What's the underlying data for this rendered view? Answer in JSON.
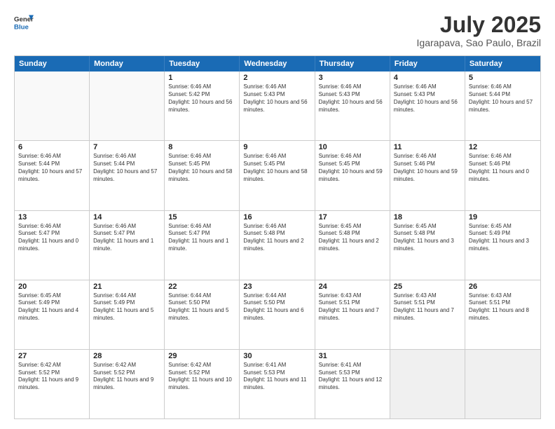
{
  "header": {
    "logo_line1": "General",
    "logo_line2": "Blue",
    "month_year": "July 2025",
    "location": "Igarapava, Sao Paulo, Brazil"
  },
  "weekdays": [
    "Sunday",
    "Monday",
    "Tuesday",
    "Wednesday",
    "Thursday",
    "Friday",
    "Saturday"
  ],
  "rows": [
    [
      {
        "day": "",
        "text": "",
        "empty": true
      },
      {
        "day": "",
        "text": "",
        "empty": true
      },
      {
        "day": "1",
        "text": "Sunrise: 6:46 AM\nSunset: 5:42 PM\nDaylight: 10 hours and 56 minutes."
      },
      {
        "day": "2",
        "text": "Sunrise: 6:46 AM\nSunset: 5:43 PM\nDaylight: 10 hours and 56 minutes."
      },
      {
        "day": "3",
        "text": "Sunrise: 6:46 AM\nSunset: 5:43 PM\nDaylight: 10 hours and 56 minutes."
      },
      {
        "day": "4",
        "text": "Sunrise: 6:46 AM\nSunset: 5:43 PM\nDaylight: 10 hours and 56 minutes."
      },
      {
        "day": "5",
        "text": "Sunrise: 6:46 AM\nSunset: 5:44 PM\nDaylight: 10 hours and 57 minutes."
      }
    ],
    [
      {
        "day": "6",
        "text": "Sunrise: 6:46 AM\nSunset: 5:44 PM\nDaylight: 10 hours and 57 minutes."
      },
      {
        "day": "7",
        "text": "Sunrise: 6:46 AM\nSunset: 5:44 PM\nDaylight: 10 hours and 57 minutes."
      },
      {
        "day": "8",
        "text": "Sunrise: 6:46 AM\nSunset: 5:45 PM\nDaylight: 10 hours and 58 minutes."
      },
      {
        "day": "9",
        "text": "Sunrise: 6:46 AM\nSunset: 5:45 PM\nDaylight: 10 hours and 58 minutes."
      },
      {
        "day": "10",
        "text": "Sunrise: 6:46 AM\nSunset: 5:45 PM\nDaylight: 10 hours and 59 minutes."
      },
      {
        "day": "11",
        "text": "Sunrise: 6:46 AM\nSunset: 5:46 PM\nDaylight: 10 hours and 59 minutes."
      },
      {
        "day": "12",
        "text": "Sunrise: 6:46 AM\nSunset: 5:46 PM\nDaylight: 11 hours and 0 minutes."
      }
    ],
    [
      {
        "day": "13",
        "text": "Sunrise: 6:46 AM\nSunset: 5:47 PM\nDaylight: 11 hours and 0 minutes."
      },
      {
        "day": "14",
        "text": "Sunrise: 6:46 AM\nSunset: 5:47 PM\nDaylight: 11 hours and 1 minute."
      },
      {
        "day": "15",
        "text": "Sunrise: 6:46 AM\nSunset: 5:47 PM\nDaylight: 11 hours and 1 minute."
      },
      {
        "day": "16",
        "text": "Sunrise: 6:46 AM\nSunset: 5:48 PM\nDaylight: 11 hours and 2 minutes."
      },
      {
        "day": "17",
        "text": "Sunrise: 6:45 AM\nSunset: 5:48 PM\nDaylight: 11 hours and 2 minutes."
      },
      {
        "day": "18",
        "text": "Sunrise: 6:45 AM\nSunset: 5:48 PM\nDaylight: 11 hours and 3 minutes."
      },
      {
        "day": "19",
        "text": "Sunrise: 6:45 AM\nSunset: 5:49 PM\nDaylight: 11 hours and 3 minutes."
      }
    ],
    [
      {
        "day": "20",
        "text": "Sunrise: 6:45 AM\nSunset: 5:49 PM\nDaylight: 11 hours and 4 minutes."
      },
      {
        "day": "21",
        "text": "Sunrise: 6:44 AM\nSunset: 5:49 PM\nDaylight: 11 hours and 5 minutes."
      },
      {
        "day": "22",
        "text": "Sunrise: 6:44 AM\nSunset: 5:50 PM\nDaylight: 11 hours and 5 minutes."
      },
      {
        "day": "23",
        "text": "Sunrise: 6:44 AM\nSunset: 5:50 PM\nDaylight: 11 hours and 6 minutes."
      },
      {
        "day": "24",
        "text": "Sunrise: 6:43 AM\nSunset: 5:51 PM\nDaylight: 11 hours and 7 minutes."
      },
      {
        "day": "25",
        "text": "Sunrise: 6:43 AM\nSunset: 5:51 PM\nDaylight: 11 hours and 7 minutes."
      },
      {
        "day": "26",
        "text": "Sunrise: 6:43 AM\nSunset: 5:51 PM\nDaylight: 11 hours and 8 minutes."
      }
    ],
    [
      {
        "day": "27",
        "text": "Sunrise: 6:42 AM\nSunset: 5:52 PM\nDaylight: 11 hours and 9 minutes."
      },
      {
        "day": "28",
        "text": "Sunrise: 6:42 AM\nSunset: 5:52 PM\nDaylight: 11 hours and 9 minutes."
      },
      {
        "day": "29",
        "text": "Sunrise: 6:42 AM\nSunset: 5:52 PM\nDaylight: 11 hours and 10 minutes."
      },
      {
        "day": "30",
        "text": "Sunrise: 6:41 AM\nSunset: 5:53 PM\nDaylight: 11 hours and 11 minutes."
      },
      {
        "day": "31",
        "text": "Sunrise: 6:41 AM\nSunset: 5:53 PM\nDaylight: 11 hours and 12 minutes."
      },
      {
        "day": "",
        "text": "",
        "empty": true,
        "shaded": true
      },
      {
        "day": "",
        "text": "",
        "empty": true,
        "shaded": true
      }
    ]
  ]
}
